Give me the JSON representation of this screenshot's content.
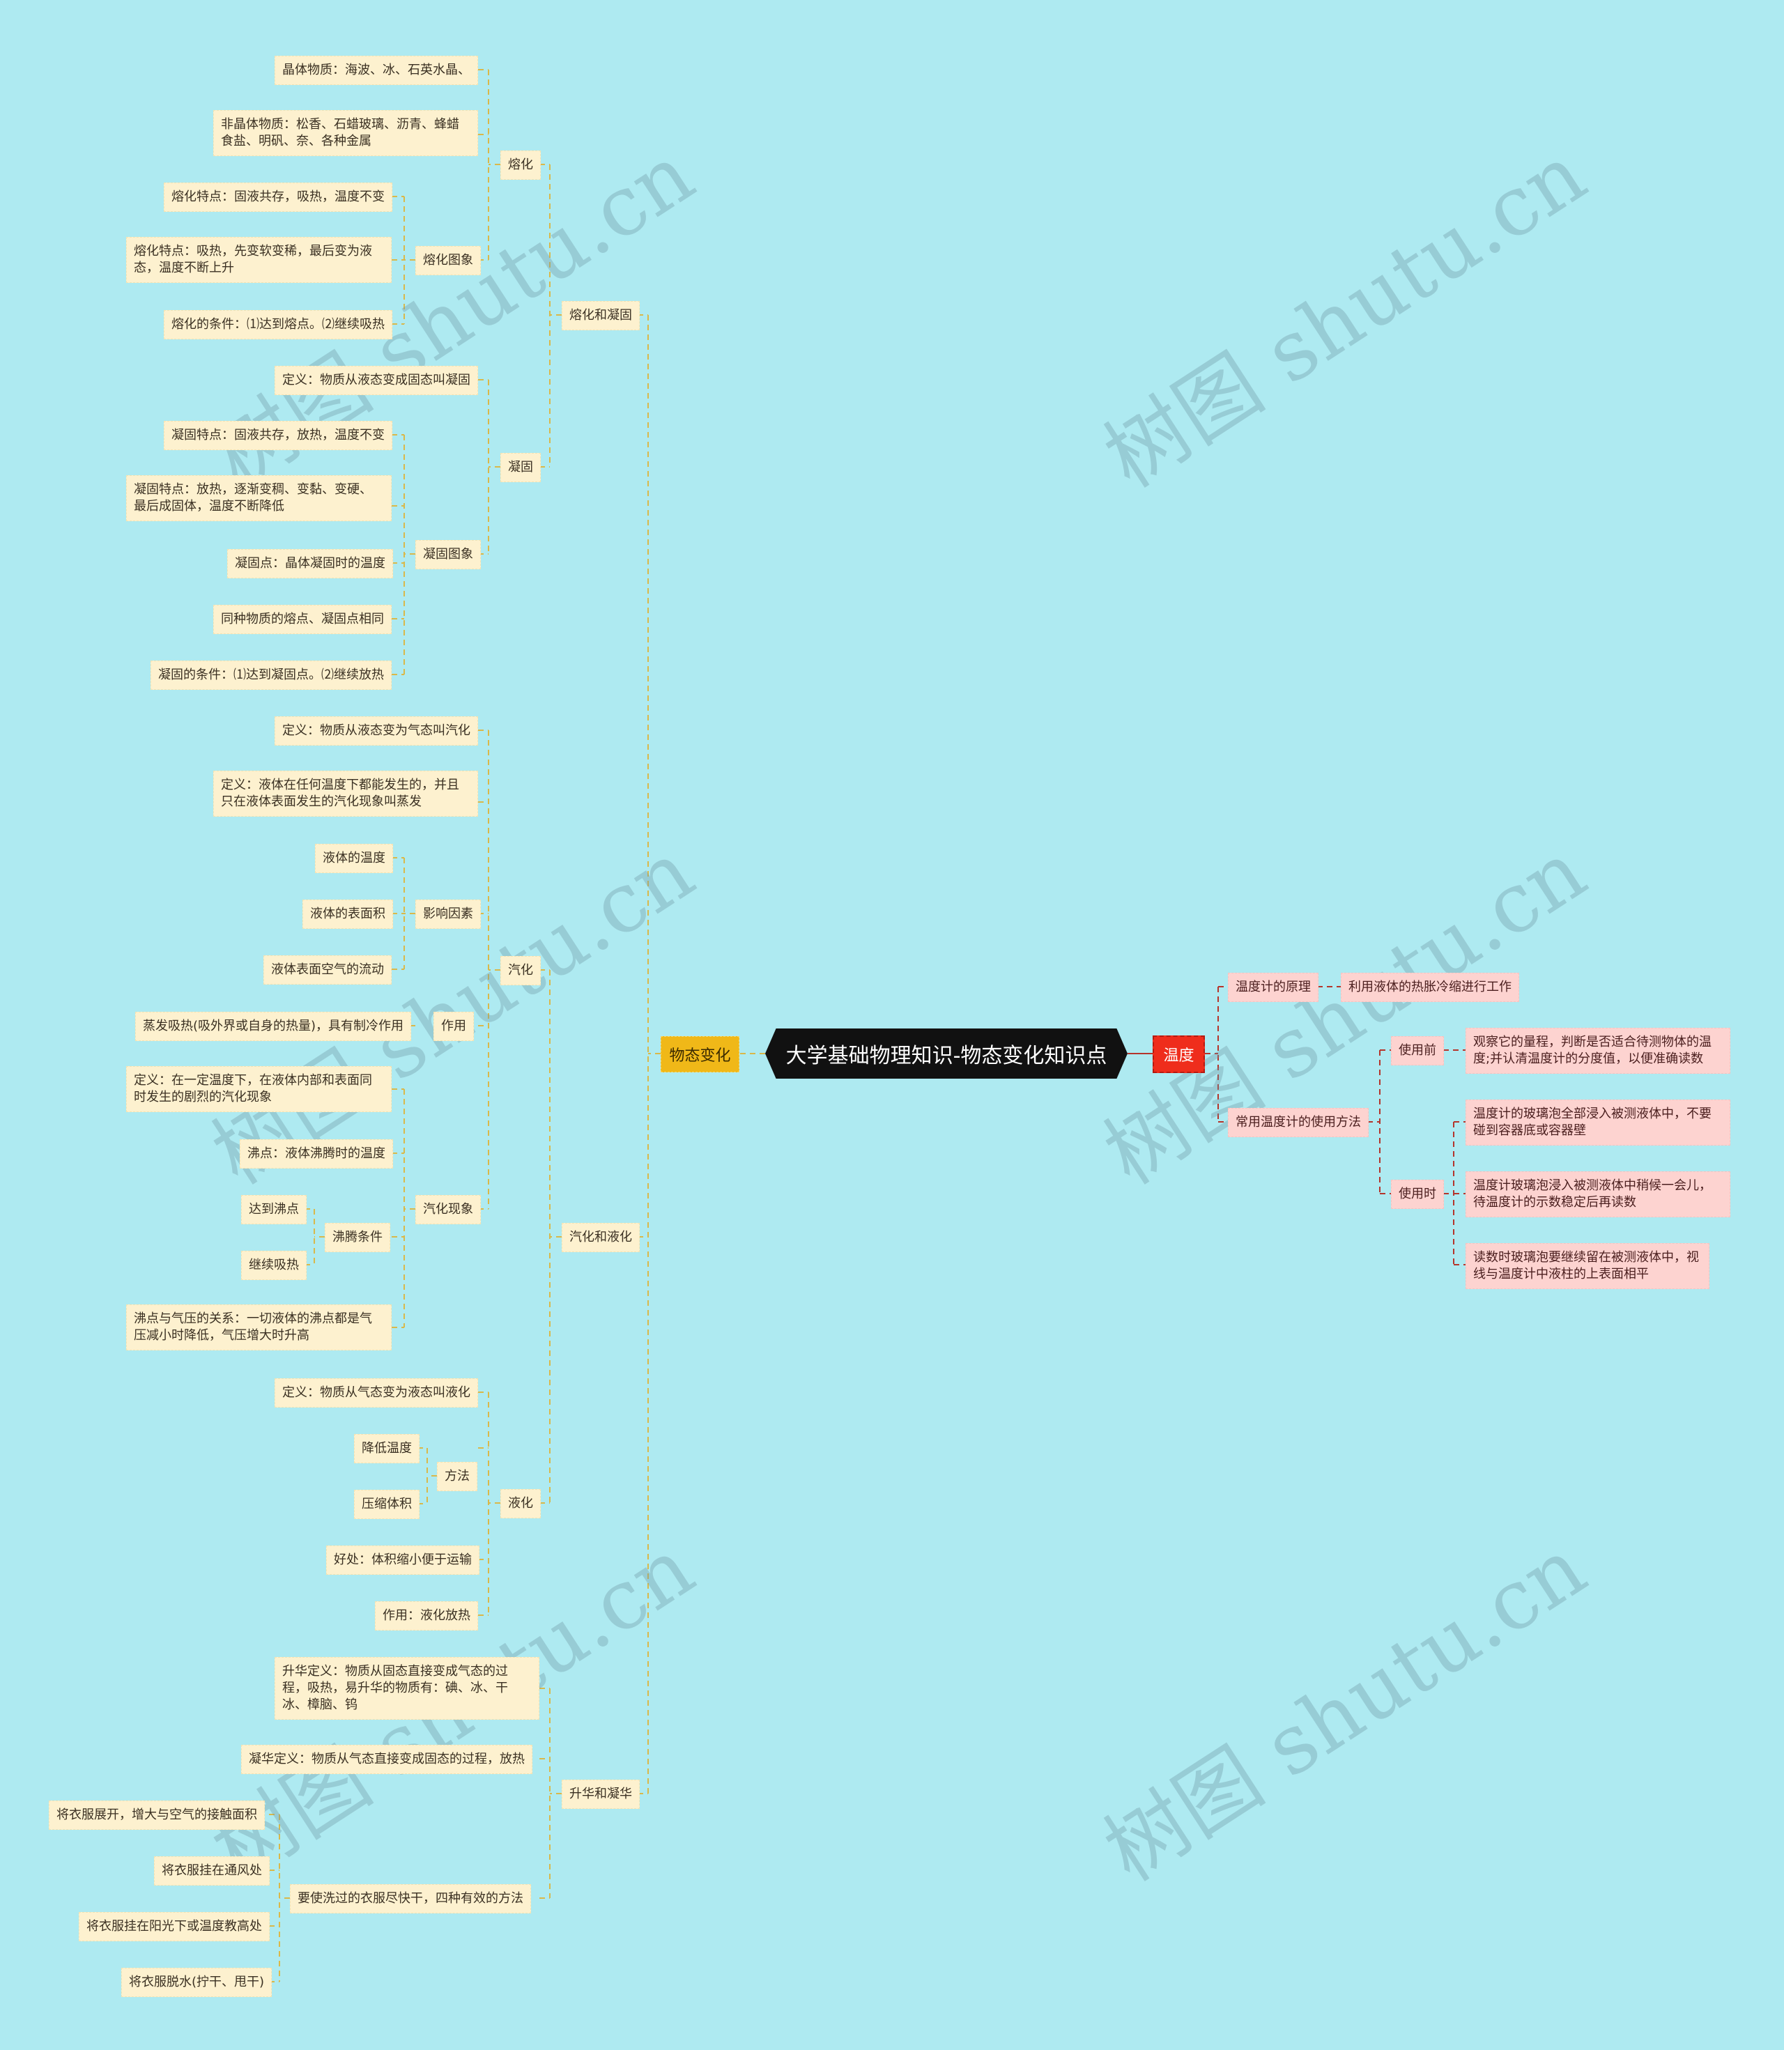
{
  "root": {
    "title": "大学基础物理知识-物态变化知识点"
  },
  "left": {
    "label": "物态变化",
    "branches": {
      "melt_freeze": {
        "label": "熔化和凝固",
        "melt": {
          "label": "熔化",
          "crystal": "晶体物质：海波、冰、石英水晶、",
          "noncrystal": "非晶体物质：松香、石蜡玻璃、沥青、蜂蜡食盐、明矾、奈、各种金属",
          "graph": {
            "label": "熔化图象",
            "items": [
              "熔化特点：固液共存，吸热，温度不变",
              "熔化特点：吸热，先变软变稀，最后变为液态，温度不断上升",
              "熔化的条件：⑴达到熔点。⑵继续吸热"
            ]
          }
        },
        "freeze": {
          "label": "凝固",
          "definition": "定义：物质从液态变成固态叫凝固",
          "graph": {
            "label": "凝固图象",
            "items": [
              "凝固特点：固液共存，放热，温度不变",
              "凝固特点：放热，逐渐变稠、变黏、变硬、最后成固体，温度不断降低",
              "凝固点：晶体凝固时的温度",
              "同种物质的熔点、凝固点相同",
              "凝固的条件：⑴达到凝固点。⑵继续放热"
            ]
          }
        }
      },
      "vapor_liquid": {
        "label": "汽化和液化",
        "vapor": {
          "label": "汽化",
          "definition": "定义：物质从液态变为气态叫汽化",
          "evaporation_def": "定义：液体在任何温度下都能发生的，并且只在液体表面发生的汽化现象叫蒸发",
          "factors": {
            "label": "影响因素",
            "items": [
              "液体的温度",
              "液体的表面积",
              "液体表面空气的流动"
            ]
          },
          "effect": {
            "label": "作用",
            "item": "蒸发吸热(吸外界或自身的热量)，具有制冷作用"
          },
          "phenomenon": {
            "label": "汽化现象",
            "boiling_def": "定义：在一定温度下，在液体内部和表面同时发生的剧烈的汽化现象",
            "boiling_point": "沸点：液体沸腾时的温度",
            "conditions": {
              "label": "沸腾条件",
              "items": [
                "达到沸点",
                "继续吸热"
              ]
            },
            "pressure": "沸点与气压的关系：一切液体的沸点都是气压减小时降低，气压增大时升高"
          }
        },
        "liquefy": {
          "label": "液化",
          "definition": "定义：物质从气态变为液态叫液化",
          "methods": {
            "label": "方法",
            "items": [
              "降低温度",
              "压缩体积"
            ]
          },
          "benefit": "好处：体积缩小便于运输",
          "effect": "作用：液化放热"
        }
      },
      "sublimation": {
        "label": "升华和凝华",
        "sublimation_def": "升华定义：物质从固态直接变成气态的过程，吸热，易升华的物质有：碘、冰、干冰、樟脑、钨",
        "deposition_def": "凝华定义：物质从气态直接变成固态的过程，放热",
        "drying": {
          "label": "要使洗过的衣服尽快干，四种有效的方法",
          "items": [
            "将衣服展开，增大与空气的接触面积",
            "将衣服挂在通风处",
            "将衣服挂在阳光下或温度教高处",
            "将衣服脱水(拧干、甩干)"
          ]
        }
      }
    }
  },
  "right": {
    "label": "温度",
    "principle": {
      "label": "温度计的原理",
      "item": "利用液体的热胀冷缩进行工作"
    },
    "usage": {
      "label": "常用温度计的使用方法",
      "before": {
        "label": "使用前",
        "item": "观察它的量程，判断是否适合待测物体的温度;并认清温度计的分度值，以便准确读数"
      },
      "during": {
        "label": "使用时",
        "items": [
          "温度计的玻璃泡全部浸入被测液体中，不要碰到容器底或容器壁",
          "温度计玻璃泡浸入被测液体中稍候一会儿，待温度计的示数稳定后再读数",
          "读数时玻璃泡要继续留在被测液体中，视线与温度计中液柱的上表面相平"
        ]
      }
    }
  },
  "watermark": {
    "text": "树图 shutu.cn"
  },
  "colors": {
    "background": "#aeeaf1",
    "left_branch": "#f0b818",
    "right_branch": "#ef2d1c",
    "left_node": "#fdf1cf",
    "right_node": "#fdd3d0",
    "left_line": "#d9b84a",
    "right_line": "#b5342b",
    "root": "#111111"
  }
}
